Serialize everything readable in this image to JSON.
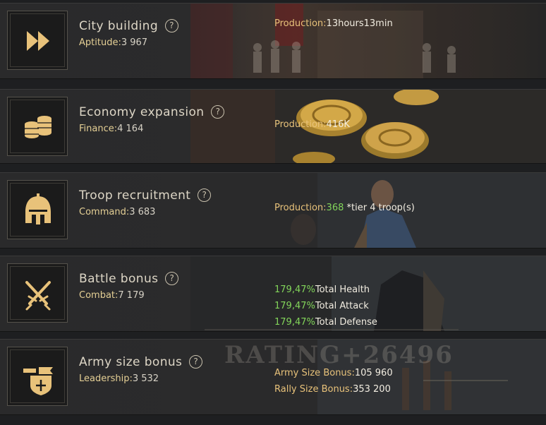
{
  "cards": [
    {
      "title": "City building",
      "stat_label": "Aptitude:",
      "stat_value": "3 967",
      "icon": "fast-forward-icon",
      "lines": [
        {
          "label": "Production:",
          "value": "13hours13min"
        }
      ]
    },
    {
      "title": "Economy expansion",
      "stat_label": "Finance:",
      "stat_value": "4 164",
      "icon": "coin-stack-icon",
      "lines": [
        {
          "label": "Production:",
          "value": "416K"
        }
      ]
    },
    {
      "title": "Troop recruitment",
      "stat_label": "Command:",
      "stat_value": "3 683",
      "icon": "helmet-icon",
      "lines": [
        {
          "label": "Production:",
          "value": "368",
          "suffix": " *tier 4 troop(s)"
        }
      ]
    },
    {
      "title": "Battle bonus",
      "stat_label": "Combat:",
      "stat_value": "7 179",
      "icon": "crossed-swords-icon",
      "lines": [
        {
          "value": "179,47%",
          "label": "Total Health"
        },
        {
          "value": "179,47%",
          "label": "Total Attack"
        },
        {
          "value": "179,47%",
          "label": "Total Defense"
        }
      ]
    },
    {
      "title": "Army size bonus",
      "stat_label": "Leadership:",
      "stat_value": "3 532",
      "icon": "banner-shield-icon",
      "lines": [
        {
          "label": "Army Size Bonus:",
          "value": "105 960"
        },
        {
          "label": "Rally Size Bonus:",
          "value": "353 200"
        }
      ]
    }
  ],
  "watermark": "RATING+26496",
  "help_glyph": "?",
  "colors": {
    "gold": "#e8c27a",
    "green": "#82d45a",
    "title": "#ddd6c6"
  }
}
